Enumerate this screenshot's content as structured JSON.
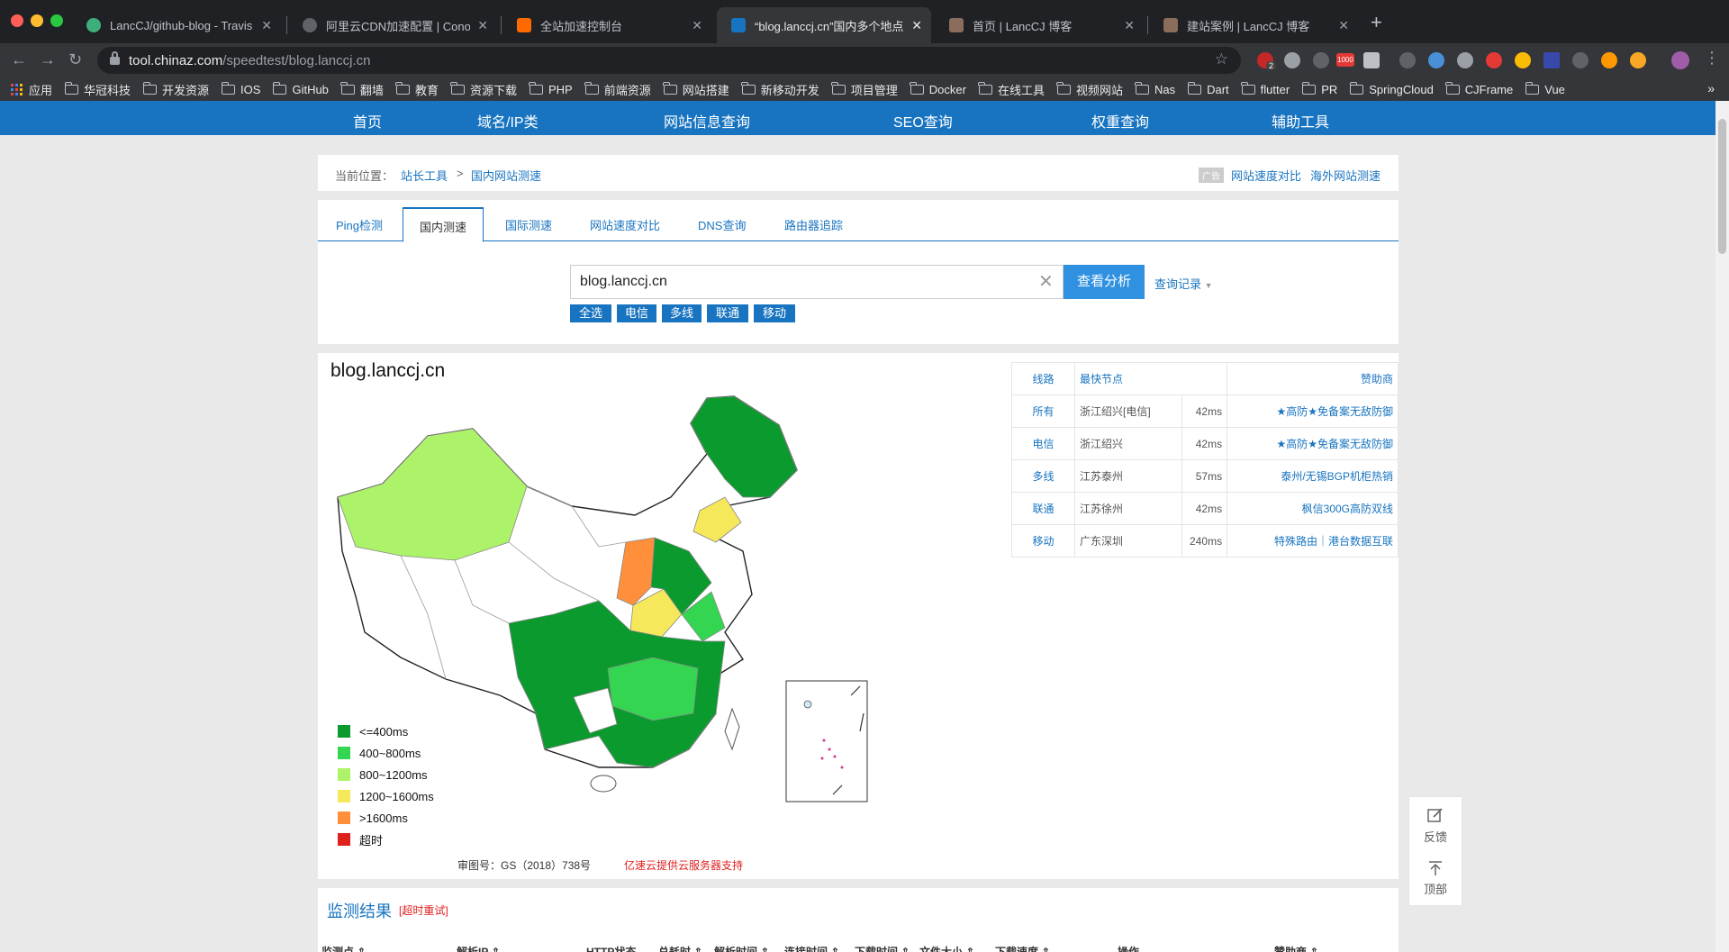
{
  "browser": {
    "tabs": [
      {
        "title": "LancCJ/github-blog - Travis CI",
        "favicon_color": "#3eaf7c"
      },
      {
        "title": "阿里云CDN加速配置 | ConorPai",
        "favicon_color": "#5f6368"
      },
      {
        "title": "全站加速控制台",
        "favicon_color": "#ff6a00"
      },
      {
        "title": "“blog.lanccj.cn”国内多个地点网",
        "favicon_color": "#1874c0",
        "active": true
      },
      {
        "title": "首页 | LancCJ 博客",
        "favicon_color": "#8a6d5a"
      },
      {
        "title": "建站案例 | LancCJ 博客",
        "favicon_color": "#8a6d5a"
      }
    ],
    "close_glyph": "✕",
    "newtab_glyph": "+",
    "url_host": "tool.chinaz.com",
    "url_path": "/speedtest/blog.lanccj.cn",
    "ext_badge": "2",
    "ext_text_1000": "1000",
    "bookmarks": [
      "华冠科技",
      "开发资源",
      "IOS",
      "GitHub",
      "翻墙",
      "教育",
      "资源下载",
      "PHP",
      "前端资源",
      "网站搭建",
      "新移动开发",
      "项目管理",
      "Docker",
      "在线工具",
      "视频网站",
      "Nas",
      "Dart",
      "flutter",
      "PR",
      "SpringCloud",
      "CJFrame",
      "Vue"
    ],
    "apps_label": "应用",
    "more_glyph": "»"
  },
  "nav": [
    "首页",
    "域名/IP类",
    "网站信息查询",
    "SEO查询",
    "权重查询",
    "辅助工具"
  ],
  "breadcrumb": {
    "label": "当前位置：",
    "items": [
      "站长工具",
      "国内网站测速"
    ],
    "sep": ">",
    "ad": "广告",
    "right_links": [
      "网站速度对比",
      "海外网站测速"
    ]
  },
  "tool_tabs": [
    "Ping检测",
    "国内测速",
    "国际测速",
    "网站速度对比",
    "DNS查询",
    "路由器追踪"
  ],
  "search": {
    "value": "blog.lanccj.cn",
    "button": "查看分析",
    "history": "查询记录",
    "chips": [
      "全选",
      "电信",
      "多线",
      "联通",
      "移动"
    ]
  },
  "map": {
    "title": "blog.lanccj.cn",
    "legend": [
      {
        "label": "<=400ms",
        "color": "#0a9a2e"
      },
      {
        "label": "400~800ms",
        "color": "#34d551"
      },
      {
        "label": "800~1200ms",
        "color": "#adf36a"
      },
      {
        "label": "1200~1600ms",
        "color": "#f5e95b"
      },
      {
        "label": ">1600ms",
        "color": "#ff8f3a"
      },
      {
        "label": "超时",
        "color": "#e0201b"
      }
    ],
    "approval": "审图号：GS（2018）738号",
    "provider": "亿速云提供云服务器支持"
  },
  "results": {
    "headers": [
      "线路",
      "最快节点",
      "赞助商"
    ],
    "rows": [
      {
        "line": "所有",
        "node": "浙江绍兴[电信]",
        "ms": "42ms",
        "sponsor": "★高防★免备案无敌防御"
      },
      {
        "line": "电信",
        "node": "浙江绍兴",
        "ms": "42ms",
        "sponsor": "★高防★免备案无敌防御"
      },
      {
        "line": "多线",
        "node": "江苏泰州",
        "ms": "57ms",
        "sponsor": "泰州/无锡BGP机柜热销"
      },
      {
        "line": "联通",
        "node": "江苏徐州",
        "ms": "42ms",
        "sponsor": "枫信300G高防双线"
      },
      {
        "line": "移动",
        "node": "广东深圳",
        "ms": "240ms",
        "sponsor": "特殊路由｜港台数据互联"
      }
    ]
  },
  "monitor": {
    "title": "监测结果",
    "retry": "[超时重试]",
    "headers": [
      "监测点 ⇕",
      "解析IP ⇕",
      "HTTP状态",
      "总耗时 ⇕",
      "解析时间 ⇕",
      "连接时间 ⇕",
      "下载时间 ⇕",
      "文件大小 ⇕",
      "下载速度 ⇕",
      "操作",
      "赞助商 ⇕"
    ]
  },
  "float": {
    "feedback": "反馈",
    "top": "顶部"
  }
}
